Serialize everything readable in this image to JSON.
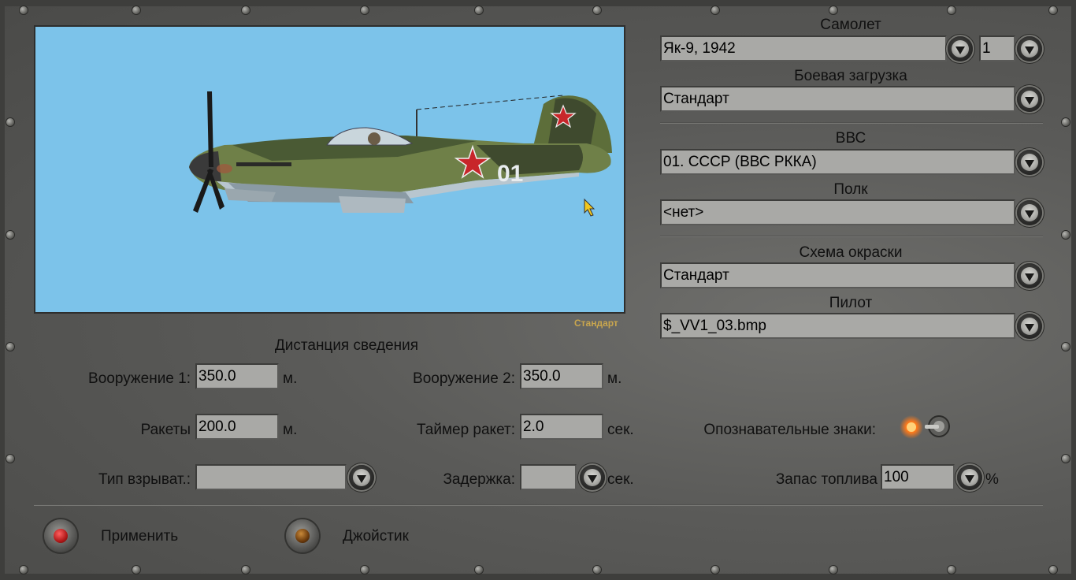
{
  "preview": {
    "caption": "Стандарт",
    "icons": [
      "aircraft-yak9-side-view",
      "red-star-insignia",
      "mouse-cursor"
    ]
  },
  "aircraft": {
    "label": "Самолет",
    "value": "Як-9, 1942",
    "count": "1"
  },
  "loadout": {
    "label": "Боевая загрузка",
    "value": "Стандарт"
  },
  "air_force": {
    "label": "ВВС",
    "value": "01. СССР (ВВС РККА)"
  },
  "regiment": {
    "label": "Полк",
    "value": "<нет>"
  },
  "skin": {
    "label": "Схема окраски",
    "value": "Стандарт"
  },
  "pilot": {
    "label": "Пилот",
    "value": "$_VV1_03.bmp"
  },
  "convergence": {
    "title": "Дистанция сведения",
    "weapon1_label": "Вооружение 1:",
    "weapon1_value": "350.0",
    "weapon1_unit": "м.",
    "weapon2_label": "Вооружение 2:",
    "weapon2_value": "350.0",
    "weapon2_unit": "м.",
    "rockets_label": "Ракеты",
    "rockets_value": "200.0",
    "rockets_unit": "м.",
    "rocket_timer_label": "Таймер ракет:",
    "rocket_timer_value": "2.0",
    "rocket_timer_unit": "сек.",
    "fuze_type_label": "Тип взрыват.:",
    "fuze_type_value": "",
    "delay_label": "Задержка:",
    "delay_value": "",
    "delay_unit": "сек."
  },
  "markings": {
    "label": "Опознавательные знаки:",
    "enabled": true
  },
  "fuel": {
    "label": "Запас топлива",
    "value": "100",
    "unit": "%"
  },
  "actions": {
    "apply_label": "Применить",
    "joystick_label": "Джойстик"
  },
  "colors": {
    "sky": "#7cc3ea",
    "field_bg": "#a9a9a6",
    "caption": "#c9a64e",
    "apply_lamp": "#b01818",
    "joystick_lamp": "#6b3a0c",
    "toggle_lamp": "#ff7a1a"
  }
}
